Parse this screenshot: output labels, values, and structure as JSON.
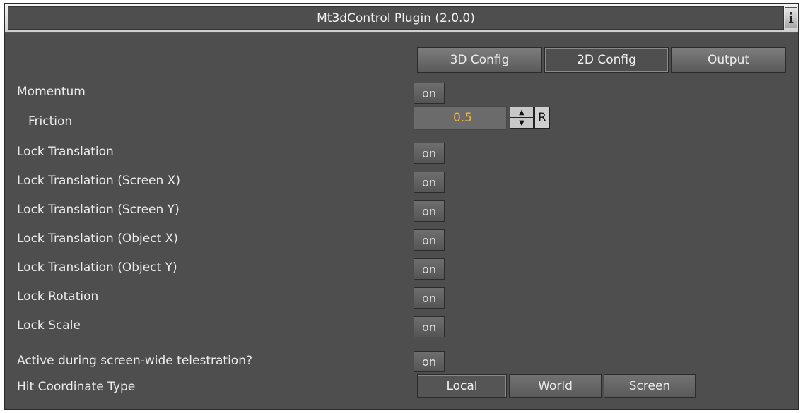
{
  "window": {
    "title": "Mt3dControl Plugin (2.0.0)",
    "info_label": "i"
  },
  "tabs": [
    {
      "label": "3D Config",
      "active": false
    },
    {
      "label": "2D Config",
      "active": true
    },
    {
      "label": "Output",
      "active": false
    }
  ],
  "settings": {
    "momentum": {
      "label": "Momentum",
      "toggle": "on"
    },
    "friction": {
      "label": "Friction",
      "value": "0.5",
      "reset_label": "R"
    },
    "lock_translation": {
      "label": "Lock Translation",
      "toggle": "on"
    },
    "lock_translation_screen_x": {
      "label": "Lock Translation (Screen X)",
      "toggle": "on"
    },
    "lock_translation_screen_y": {
      "label": "Lock Translation (Screen Y)",
      "toggle": "on"
    },
    "lock_translation_object_x": {
      "label": "Lock Translation (Object X)",
      "toggle": "on"
    },
    "lock_translation_object_y": {
      "label": "Lock Translation (Object Y)",
      "toggle": "on"
    },
    "lock_rotation": {
      "label": "Lock Rotation",
      "toggle": "on"
    },
    "lock_scale": {
      "label": "Lock Scale",
      "toggle": "on"
    },
    "active_telestration": {
      "label": "Active during screen-wide telestration?",
      "toggle": "on"
    },
    "hit_coordinate_type": {
      "label": "Hit Coordinate Type",
      "options": [
        "Local",
        "World",
        "Screen"
      ],
      "selected": "Local"
    }
  },
  "colors": {
    "panel": "#4e4e4e",
    "value_accent": "#f2b544"
  }
}
